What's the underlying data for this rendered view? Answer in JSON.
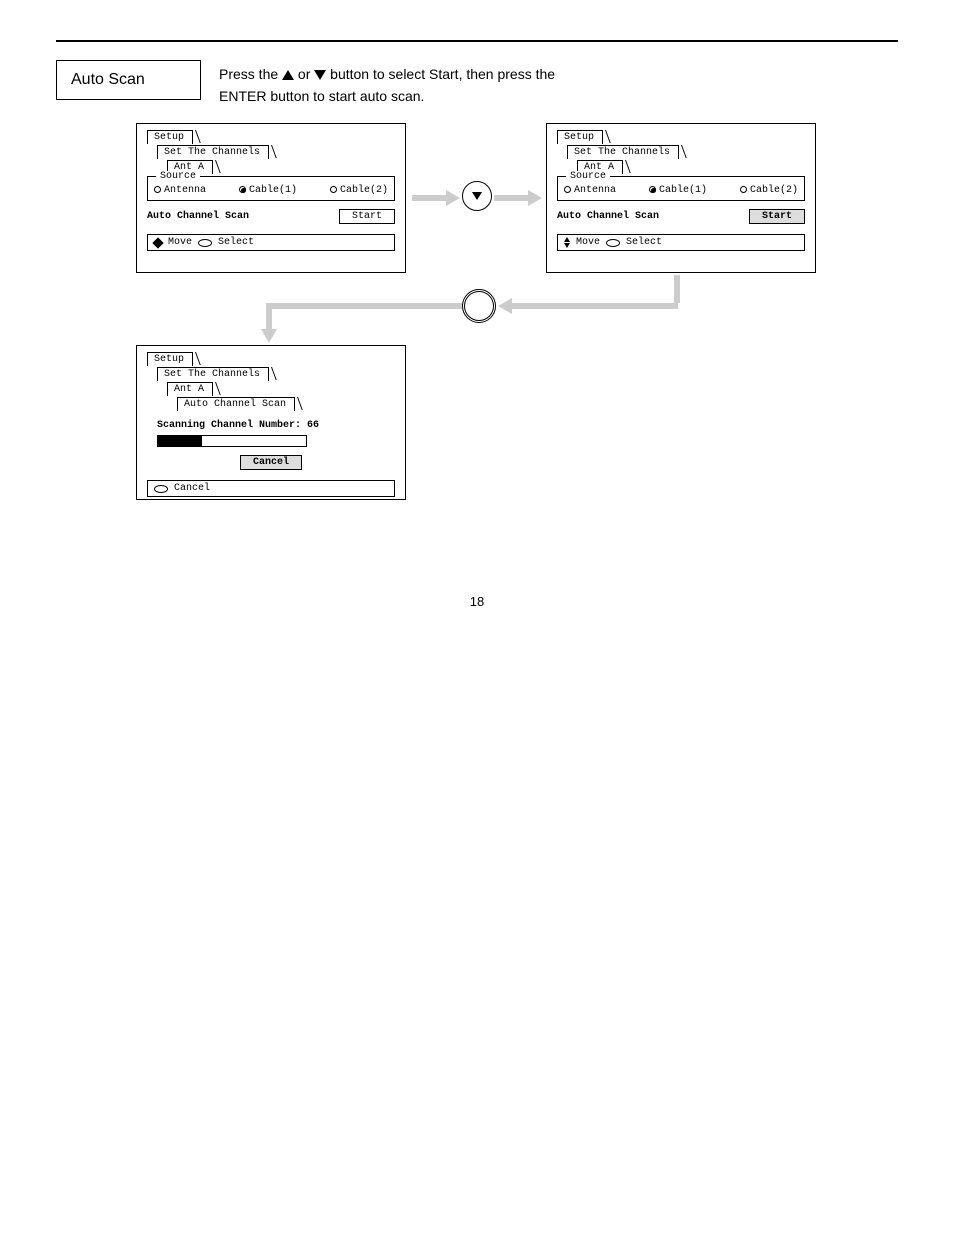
{
  "page_number": "18",
  "section": {
    "label": "Auto Scan",
    "line1_pre": "Press the ",
    "line1_mid1": " or ",
    "line1_post": " button to select Start, then press the",
    "line2": "ENTER button to start auto scan."
  },
  "panel1": {
    "title": "Setup",
    "sub1": "Set The Channels",
    "sub2": "Ant A",
    "source_legend": "Source",
    "opt_antenna": "Antenna",
    "opt_cable1": "Cable(1)",
    "opt_cable2": "Cable(2)",
    "scan_label": "Auto Channel Scan",
    "start_btn": "Start",
    "nav_move": "Move",
    "nav_select": "Select"
  },
  "panel2": {
    "title": "Setup",
    "sub1": "Set The Channels",
    "sub2": "Ant A",
    "source_legend": "Source",
    "opt_antenna": "Antenna",
    "opt_cable1": "Cable(1)",
    "opt_cable2": "Cable(2)",
    "scan_label": "Auto Channel Scan",
    "start_btn": "Start",
    "nav_move": "Move",
    "nav_select": "Select"
  },
  "panel3": {
    "title": "Setup",
    "sub1": "Set The Channels",
    "sub2": "Ant A",
    "sub3": "Auto Channel Scan",
    "scan_msg": "Scanning Channel Number: 66",
    "progress_pct": 30,
    "cancel_btn": "Cancel",
    "nav_cancel": "Cancel"
  }
}
